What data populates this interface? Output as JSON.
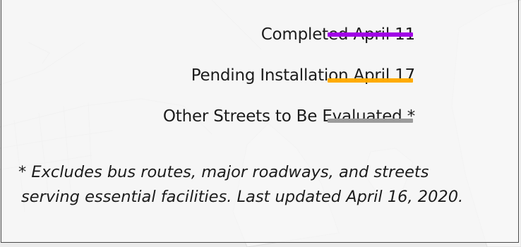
{
  "legend": {
    "items": [
      {
        "label": "Completed April 11",
        "color": "#a100e6"
      },
      {
        "label": "Pending Installation April 17",
        "color": "#ffab00"
      },
      {
        "label": "Other Streets to Be Evaluated *",
        "color": "#9b9b9b"
      }
    ]
  },
  "footnote": {
    "line1": "* Excludes bus routes, major roadways, and streets",
    "line2": "serving essential facilities. Last updated April 16, 2020."
  }
}
